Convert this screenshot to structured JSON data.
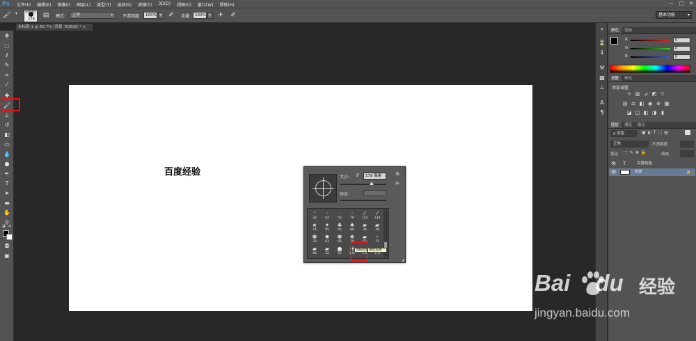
{
  "app": {
    "logo": "Ps"
  },
  "menu": [
    "文件(F)",
    "编辑(E)",
    "图像(I)",
    "图层(L)",
    "类型(Y)",
    "选择(S)",
    "滤镜(T)",
    "3D(D)",
    "视图(V)",
    "窗口(W)",
    "帮助(H)"
  ],
  "window_controls": {
    "minimize": "—",
    "maximize": "□",
    "close": "✕"
  },
  "options": {
    "brush_size": "178",
    "brush_size_caption": "画笔预设",
    "mode_label": "模式:",
    "mode_value": "正常",
    "opacity_label": "不透明度:",
    "opacity_value": "100%",
    "flow_label": "流量:",
    "flow_value": "100%",
    "workspace": "基本功能"
  },
  "document_tab": "未标题-1 @ 66.7% (背景, RGB/8) * ×",
  "canvas": {
    "text": "百度经验"
  },
  "brush_popup": {
    "size_label": "大小:",
    "size_value": "178 像素",
    "hardness_label": "硬度:",
    "tooltip": "顶级粒草 硬度较粗",
    "brush_numbers": [
      [
        "33",
        "42",
        "55",
        "70",
        "112",
        "134"
      ],
      [
        "74",
        "95",
        "95",
        "90",
        "36",
        "36"
      ],
      [
        "33",
        "63",
        "66",
        "39",
        "63",
        "11"
      ],
      [
        "48",
        "32",
        "55",
        "100",
        "178",
        "178"
      ]
    ],
    "brush_shapes": [
      [
        "⁺",
        "·",
        "·",
        "·",
        "⁄",
        "⁄"
      ],
      [
        "★",
        "✦",
        "♣",
        "♠",
        "▰",
        "▰"
      ],
      [
        "✽",
        "✹",
        "✽",
        "❖",
        "▰",
        "⁃"
      ],
      [
        "▰",
        "▰",
        "●",
        "❀",
        "▰",
        "▰"
      ]
    ]
  },
  "color_panel": {
    "tabs": [
      "颜色",
      "色板"
    ],
    "channels": [
      {
        "label": "R",
        "value": "0",
        "color": "#ff2020"
      },
      {
        "label": "G",
        "value": "0",
        "color": "#20e020"
      },
      {
        "label": "B",
        "value": "0",
        "color": "#2060ff"
      }
    ]
  },
  "adjustments_panel": {
    "tabs": [
      "调整",
      "样式"
    ],
    "title": "添加调整"
  },
  "layers_panel": {
    "tabs": [
      "图层",
      "通道",
      "路径"
    ],
    "kind_label": "ρ 类型",
    "blend_mode": "正常",
    "opacity_label": "不透明度:",
    "lock_label": "锁定:",
    "fill_label": "填充:",
    "layers": [
      {
        "name": "百度经验",
        "type": "T"
      },
      {
        "name": "背景",
        "type": "image"
      }
    ]
  },
  "watermark": {
    "brand": "Bai",
    "brand2": "du",
    "label": "经验",
    "url": "jingyan.baidu.com"
  }
}
